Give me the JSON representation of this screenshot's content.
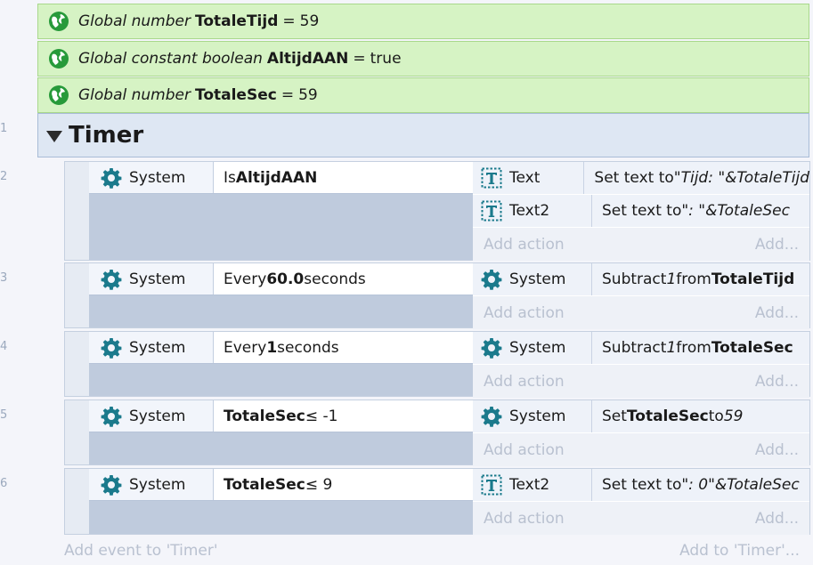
{
  "line_numbers": [
    "1",
    "2",
    "3",
    "4",
    "5",
    "6"
  ],
  "globals": [
    {
      "kind": "Global number",
      "name": "TotaleTijd",
      "op": "=",
      "value": "59"
    },
    {
      "kind": "Global constant boolean",
      "name": "AltijdAAN",
      "op": "=",
      "value": "true"
    },
    {
      "kind": "Global number",
      "name": "TotaleSec",
      "op": "=",
      "value": "59"
    }
  ],
  "group": {
    "title": "Timer"
  },
  "events": [
    {
      "condition": {
        "object": "System",
        "parts": [
          "Is ",
          "AltijdAAN",
          ""
        ]
      },
      "actions": [
        {
          "object": "Text",
          "icon": "text-object-icon",
          "parts": [
            "Set text to ",
            "\"Tijd: \"&TotaleTijd",
            ""
          ]
        },
        {
          "object": "Text2",
          "icon": "text-object-icon",
          "parts": [
            "Set text to ",
            "\": \"&TotaleSec",
            ""
          ]
        }
      ]
    },
    {
      "condition": {
        "object": "System",
        "parts": [
          "Every ",
          "60.0",
          " seconds"
        ]
      },
      "actions": [
        {
          "object": "System",
          "icon": "gear-icon",
          "parts": [
            "Subtract ",
            "1",
            " from ",
            "TotaleTijd"
          ]
        }
      ]
    },
    {
      "condition": {
        "object": "System",
        "parts": [
          "Every ",
          "1",
          " seconds"
        ]
      },
      "actions": [
        {
          "object": "System",
          "icon": "gear-icon",
          "parts": [
            "Subtract ",
            "1",
            " from ",
            "TotaleSec"
          ]
        }
      ]
    },
    {
      "condition": {
        "object": "System",
        "parts": [
          "",
          "TotaleSec",
          " ≤ -1"
        ]
      },
      "actions": [
        {
          "object": "System",
          "icon": "gear-icon",
          "parts": [
            "Set ",
            "TotaleSec",
            " to ",
            "59"
          ]
        }
      ]
    },
    {
      "condition": {
        "object": "System",
        "parts": [
          "",
          "TotaleSec",
          " ≤ 9"
        ]
      },
      "actions": [
        {
          "object": "Text2",
          "icon": "text-object-icon",
          "parts": [
            "Set text to ",
            "\": 0\"&TotaleSec",
            ""
          ]
        }
      ]
    }
  ],
  "labels": {
    "add_action": "Add action",
    "add_more": "Add...",
    "add_event": "Add event to 'Timer'",
    "add_to": "Add to 'Timer'..."
  },
  "colors": {
    "global_bg": "#d6f3c4",
    "group_bg": "#dee7f3",
    "icon_teal": "#1b7a8c"
  }
}
